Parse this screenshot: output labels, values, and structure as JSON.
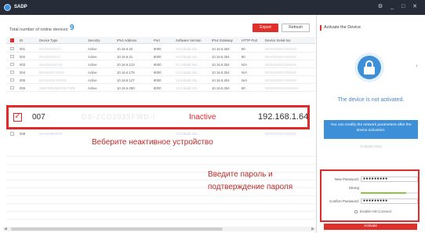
{
  "app": {
    "title": "SADP",
    "window_controls": "⚙ _ □ ✕"
  },
  "toolbar": {
    "count_label": "Total number of online devices:",
    "count_value": "9",
    "export_label": "Export",
    "refresh_label": "Refresh"
  },
  "table": {
    "columns": [
      "ID",
      "Device Type",
      "Security",
      "IPv4 Address",
      "Port",
      "Software Version",
      "IPv4 Gateway",
      "HTTP Port",
      "Device Serial No."
    ],
    "rows": [
      {
        "id": "001",
        "type": "DS-XXXXXX-X",
        "security": "Active",
        "ip": "10.16.6.20",
        "port": "8000",
        "software": "V5.3.0build 150...",
        "gateway": "10.16.6.254",
        "http": "80",
        "serial": "DS-XXXXXX-XXXXXX"
      },
      {
        "id": "002",
        "type": "DS-XXXXXX-X",
        "security": "Active",
        "ip": "10.16.6.21",
        "port": "8000",
        "software": "V5.3.0build 150...",
        "gateway": "10.16.6.254",
        "http": "80",
        "serial": "DS-XXXXXX-XXXXXX"
      },
      {
        "id": "003",
        "type": "DS-XXXXXX-XX",
        "security": "Active",
        "ip": "10.16.6.213",
        "port": "8000",
        "software": "V1.1.0build 160...",
        "gateway": "10.16.6.254",
        "http": "N/A",
        "serial": "DS-XXXXXX-XXXXXX"
      },
      {
        "id": "004",
        "type": "DS-XXXXX-XXXX",
        "security": "Active",
        "ip": "10.16.6.179",
        "port": "8000",
        "software": "V1.0.1build 160...",
        "gateway": "10.16.6.254",
        "http": "N/A",
        "serial": "DS-XXXXXX-XXXXXX"
      },
      {
        "id": "005",
        "type": "DS-XXXXX-XXXXX",
        "security": "Active",
        "ip": "10.16.6.127",
        "port": "8000",
        "software": "V2.2.0build 160...",
        "gateway": "10.16.6.254",
        "http": "N/A",
        "serial": "DS-XXXXXX-XXXXXX"
      },
      {
        "id": "006",
        "type": "UNKOWN-DEVICE-TYPE",
        "security": "Active",
        "ip": "10.16.6.250",
        "port": "8000",
        "software": "V5.2.1build 150...",
        "gateway": "10.16.6.254",
        "http": "80",
        "serial": "XXXXXXXXXXXXXXXX"
      }
    ],
    "selected_row": {
      "id": "007",
      "type": "DS-2CD2025FWD-I",
      "security": "Inactive",
      "ip": "192.168.1.64"
    },
    "row_008": {
      "id": "008",
      "type": "DS-19A08-0XXX",
      "software": "V1.0.0build 160...",
      "serial": "DS-XXXXXX-XXXXXX"
    }
  },
  "annotations": {
    "select_inactive": "Веберите неактивное устройство",
    "enter_password_line1": "Введите пароль и",
    "enter_password_line2": "подтверждение пароля"
  },
  "side_panel": {
    "title": "Activate the Device",
    "status_text": "The device is not activated.",
    "info_text": "You can modify the network parameters after the device activation.",
    "activate_now_label": "Activate Now",
    "new_password_label": "New Password:",
    "new_password_value": "●●●●●●●●●",
    "strength_label": "Strong",
    "strength_level": 0.8,
    "confirm_password_label": "Confirm Password:",
    "confirm_password_value": "●●●●●●●●●",
    "hik_connect_label": "Enable Hik-Connect",
    "activate_button_label": "Activate"
  },
  "colors": {
    "accent_red": "#e0302b",
    "accent_blue": "#3d8fd8",
    "titlebar": "#262d39"
  }
}
